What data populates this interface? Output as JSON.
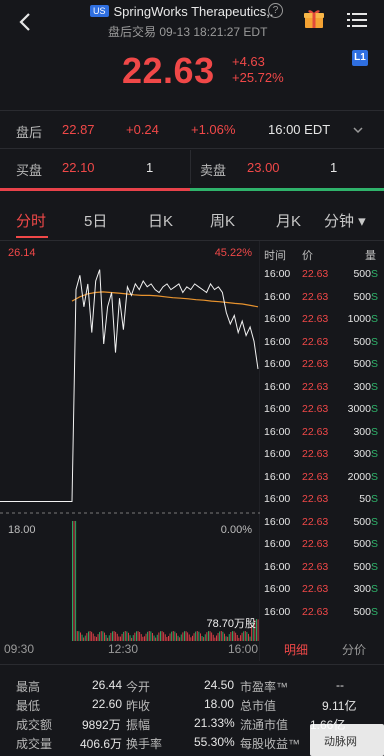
{
  "header": {
    "exchange_badge": "US",
    "title": "SpringWorks Therapeutics,.",
    "help_glyph": "?",
    "subtitle": "盘后交易 09-13 18:21:27 EDT",
    "price": "22.63",
    "change": "+4.63",
    "change_pct": "+25.72%",
    "level_badge": "L1"
  },
  "afterhours": {
    "label": "盘后",
    "price": "22.87",
    "change": "+0.24",
    "change_pct": "+1.06%",
    "time": "16:00 EDT"
  },
  "bidask": {
    "bid_label": "买盘",
    "bid_price": "22.10",
    "bid_size": "1",
    "ask_label": "卖盘",
    "ask_price": "23.00",
    "ask_size": "1"
  },
  "tabs": [
    "分时",
    "5日",
    "日K",
    "周K",
    "月K",
    "分钟 ▾"
  ],
  "chart": {
    "max_label": "26.14",
    "max_pct": "45.22%",
    "base_label": "18.00",
    "base_pct": "0.00%",
    "volume_label": "78.70万股",
    "x_start": "09:30",
    "x_mid": "12:30",
    "x_end": "16:00",
    "price_series": [
      18.0,
      25.4,
      25.9,
      24.8,
      25.6,
      23.9,
      25.7,
      26.1,
      23.5,
      24.8,
      25.3,
      23.2,
      25.1,
      24.0,
      25.5,
      25.2,
      25.6,
      25.4,
      25.7,
      25.5,
      25.6,
      25.4,
      25.3,
      25.5,
      25.6,
      25.4,
      25.5,
      25.6,
      25.3,
      25.5,
      25.4,
      25.6,
      25.5,
      25.4,
      25.3,
      25.6,
      25.4,
      25.5,
      25.3,
      24.6,
      24.2,
      24.5,
      23.9,
      24.3,
      23.8,
      24.1,
      23.6,
      22.63
    ],
    "avg_series": [
      25.0,
      25.15,
      25.25,
      25.3,
      25.32,
      25.3,
      25.28,
      25.25,
      25.22,
      25.2,
      25.2,
      25.18,
      25.15,
      25.12,
      25.1,
      25.08,
      25.05,
      25.03,
      25.0,
      24.98,
      24.95,
      24.92,
      24.9,
      24.85,
      24.8
    ]
  },
  "ticks_header": {
    "time": "时间",
    "price": "价",
    "vol": "量"
  },
  "ticks": [
    {
      "time": "16:00",
      "price": "22.63",
      "vol": "500"
    },
    {
      "time": "16:00",
      "price": "22.63",
      "vol": "500"
    },
    {
      "time": "16:00",
      "price": "22.63",
      "vol": "1000"
    },
    {
      "time": "16:00",
      "price": "22.63",
      "vol": "500"
    },
    {
      "time": "16:00",
      "price": "22.63",
      "vol": "500"
    },
    {
      "time": "16:00",
      "price": "22.63",
      "vol": "300"
    },
    {
      "time": "16:00",
      "price": "22.63",
      "vol": "3000"
    },
    {
      "time": "16:00",
      "price": "22.63",
      "vol": "300"
    },
    {
      "time": "16:00",
      "price": "22.63",
      "vol": "300"
    },
    {
      "time": "16:00",
      "price": "22.63",
      "vol": "2000"
    },
    {
      "time": "16:00",
      "price": "22.63",
      "vol": "50"
    },
    {
      "time": "16:00",
      "price": "22.63",
      "vol": "500"
    },
    {
      "time": "16:00",
      "price": "22.63",
      "vol": "500"
    },
    {
      "time": "16:00",
      "price": "22.63",
      "vol": "500"
    },
    {
      "time": "16:00",
      "price": "22.63",
      "vol": "300"
    },
    {
      "time": "16:00",
      "price": "22.63",
      "vol": "500"
    }
  ],
  "tick_side": "S",
  "side_tabs": {
    "detail": "明细",
    "price_split": "分价"
  },
  "stats": {
    "high_k": "最高",
    "high_v": "26.44",
    "open_k": "今开",
    "open_v": "24.50",
    "pe_k": "市盈率™",
    "pe_v": "--",
    "low_k": "最低",
    "low_v": "22.60",
    "prev_k": "昨收",
    "prev_v": "18.00",
    "mcap_k": "总市值",
    "mcap_v": "9.11亿",
    "turnover_k": "成交额",
    "turnover_v": "9892万",
    "amp_k": "振幅",
    "amp_v": "21.33%",
    "float_k": "流通市值",
    "float_v": "1.66亿",
    "vol_k": "成交量",
    "vol_v": "406.6万",
    "tr_k": "换手率",
    "tr_v": "55.30%",
    "eps_k": "每股收益™",
    "eps_v": "--"
  },
  "watermark": "动脉网"
}
